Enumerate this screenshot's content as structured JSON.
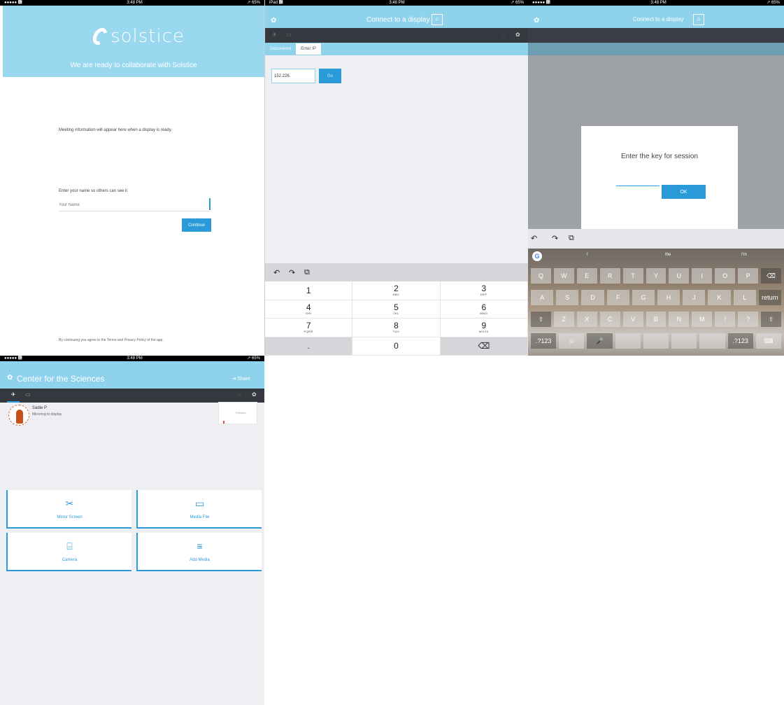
{
  "panel1": {
    "status": {
      "left": "●●●●● ᝹",
      "center": "3:48 PM",
      "right": "↗ 65%"
    },
    "logo_text": "solstice",
    "welcome": "We are ready to collaborate with Solstice",
    "body": "Meeting information will appear here when a display is ready.",
    "field_label": "Enter your name so others can see it",
    "name_placeholder": "Your Name",
    "continue_label": "Continue",
    "footer": "By continuing you agree to the Terms and Privacy Policy of the app."
  },
  "panel2": {
    "status": {
      "left": "iPad ᝹",
      "center": "3:48 PM",
      "right": "↗ 65%"
    },
    "title": "Connect to a display",
    "tabs": [
      "Discovered",
      "Enter IP"
    ],
    "ip_value": "152.226.",
    "go_label": "Go",
    "keys": [
      {
        "n": "1",
        "l": ""
      },
      {
        "n": "2",
        "l": "ABC"
      },
      {
        "n": "3",
        "l": "DEF"
      },
      {
        "n": "4",
        "l": "GHI"
      },
      {
        "n": "5",
        "l": "JKL"
      },
      {
        "n": "6",
        "l": "MNO"
      },
      {
        "n": "7",
        "l": "PQRS"
      },
      {
        "n": "8",
        "l": "TUV"
      },
      {
        "n": "9",
        "l": "WXYZ"
      },
      {
        "n": ".",
        "l": ""
      },
      {
        "n": "0",
        "l": ""
      },
      {
        "n": "⌫",
        "l": ""
      }
    ]
  },
  "panel3": {
    "status": {
      "left": "●●●●● ᝹",
      "center": "3:48 PM",
      "right": "↗ 65%"
    },
    "title": "Connect to a display",
    "dialog_title": "Enter the key for session",
    "code_value": "",
    "ok_label": "OK",
    "suggestions": [
      "I",
      "the",
      "I'm"
    ],
    "rows": [
      [
        "Q",
        "W",
        "E",
        "R",
        "T",
        "Y",
        "U",
        "I",
        "O",
        "P",
        "⌫"
      ],
      [
        "A",
        "S",
        "D",
        "F",
        "G",
        "H",
        "J",
        "K",
        "L",
        "return"
      ],
      [
        "⇧",
        "Z",
        "X",
        "C",
        "V",
        "B",
        "N",
        "M",
        "!",
        "?",
        "⇧"
      ],
      [
        ".?123",
        "☺",
        "🎤",
        "",
        "",
        "",
        "",
        ".?123",
        "⌨"
      ]
    ]
  },
  "panel4": {
    "status": {
      "left": "●●●●● ᝹",
      "center": "3:48 PM",
      "right": "↗ 65%"
    },
    "title": "Center for the Sciences",
    "share_label": "⇥ Share",
    "user_name": "Sadie P",
    "user_status": "Mirroring to display",
    "preview_text": "Preview",
    "tiles": [
      {
        "icon": "✂",
        "label": "Mirror Screen"
      },
      {
        "icon": "▭",
        "label": "Media File"
      },
      {
        "icon": "⌸",
        "label": "Camera"
      },
      {
        "icon": "≡",
        "label": "Add Media"
      }
    ]
  }
}
